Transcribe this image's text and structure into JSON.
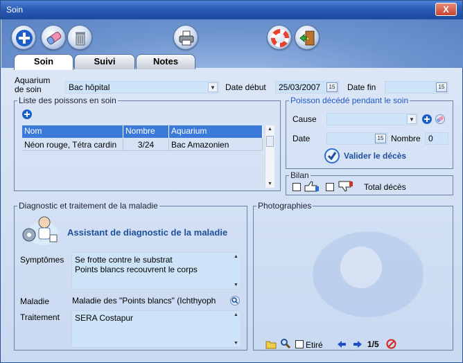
{
  "window": {
    "title": "Soin",
    "close_label": "X"
  },
  "tabs": [
    {
      "label": "Soin",
      "active": true
    },
    {
      "label": "Suivi",
      "active": false
    },
    {
      "label": "Notes",
      "active": false
    }
  ],
  "form": {
    "aquarium_label": "Aquarium\nde soin",
    "aquarium_value": "Bac hôpital",
    "date_debut_label": "Date début",
    "date_debut_value": "25/03/2007",
    "date_fin_label": "Date fin",
    "date_fin_value": "  /  /",
    "calendar_label": "15"
  },
  "fish_list": {
    "legend": "Liste des poissons en soin",
    "columns": [
      "Nom",
      "Nombre",
      "Aquarium"
    ],
    "rows": [
      {
        "nom": "Néon rouge, Tétra cardin",
        "nombre": "3/24",
        "aquarium": "Bac Amazonien"
      }
    ]
  },
  "dead_fish": {
    "legend": "Poisson décédé pendant le soin",
    "cause_label": "Cause",
    "cause_value": "",
    "date_label": "Date",
    "date_value": "  /  /",
    "nombre_label": "Nombre",
    "nombre_value": "0",
    "validate_label": "Valider le décès"
  },
  "bilan": {
    "legend": "Bilan",
    "total_label": "Total décès"
  },
  "diagnostic": {
    "legend": "Diagnostic et traitement de la maladie",
    "assistant_label": "Assistant de diagnostic de la maladie",
    "symptomes_label": "Symptômes",
    "symptomes_value": "Se frotte contre le substrat\nPoints blancs recouvrent le corps",
    "maladie_label": "Maladie",
    "maladie_value": "Maladie des \"Points blancs\" (Ichthyoph",
    "traitement_label": "Traitement",
    "traitement_value": "SERA Costapur"
  },
  "photos": {
    "legend": "Photographies",
    "etire_label": "Etiré",
    "page_indicator": "1/5"
  },
  "colors": {
    "title_blue": "#2a5bb3",
    "field_bg": "#cde4f8",
    "header_blue": "#3c7ad9",
    "link_blue": "#1f58c8",
    "assistant_blue": "#1d4f9a"
  }
}
